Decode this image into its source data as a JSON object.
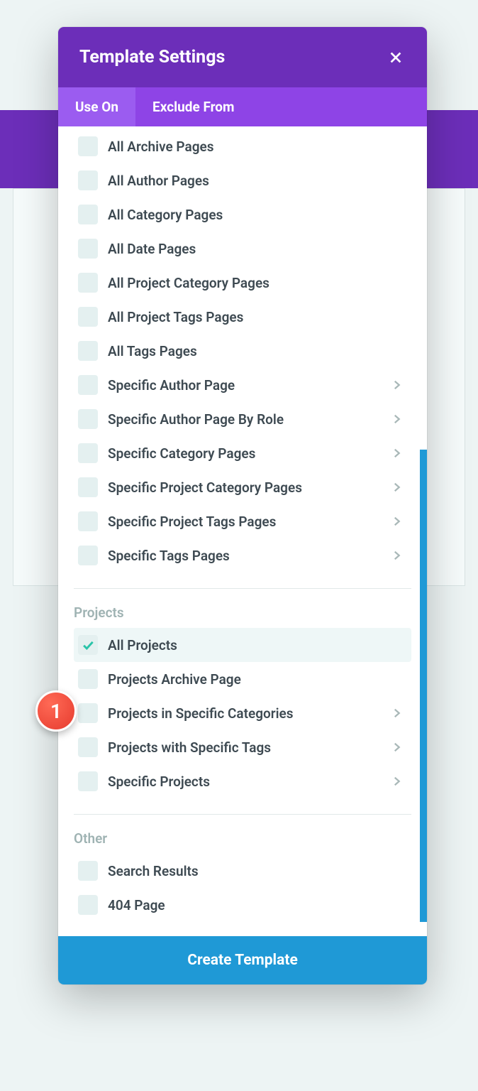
{
  "modal": {
    "title": "Template Settings",
    "tabs": {
      "use_on": "Use On",
      "exclude_from": "Exclude From"
    },
    "groups": [
      {
        "title": "",
        "items": [
          {
            "label": "All Archive Pages",
            "checked": false,
            "chevron": false
          },
          {
            "label": "All Author Pages",
            "checked": false,
            "chevron": false
          },
          {
            "label": "All Category Pages",
            "checked": false,
            "chevron": false
          },
          {
            "label": "All Date Pages",
            "checked": false,
            "chevron": false
          },
          {
            "label": "All Project Category Pages",
            "checked": false,
            "chevron": false
          },
          {
            "label": "All Project Tags Pages",
            "checked": false,
            "chevron": false
          },
          {
            "label": "All Tags Pages",
            "checked": false,
            "chevron": false
          },
          {
            "label": "Specific Author Page",
            "checked": false,
            "chevron": true
          },
          {
            "label": "Specific Author Page By Role",
            "checked": false,
            "chevron": true
          },
          {
            "label": "Specific Category Pages",
            "checked": false,
            "chevron": true
          },
          {
            "label": "Specific Project Category Pages",
            "checked": false,
            "chevron": true
          },
          {
            "label": "Specific Project Tags Pages",
            "checked": false,
            "chevron": true
          },
          {
            "label": "Specific Tags Pages",
            "checked": false,
            "chevron": true
          }
        ]
      },
      {
        "title": "Projects",
        "items": [
          {
            "label": "All Projects",
            "checked": true,
            "chevron": false
          },
          {
            "label": "Projects Archive Page",
            "checked": false,
            "chevron": false
          },
          {
            "label": "Projects in Specific Categories",
            "checked": false,
            "chevron": true
          },
          {
            "label": "Projects with Specific Tags",
            "checked": false,
            "chevron": true
          },
          {
            "label": "Specific Projects",
            "checked": false,
            "chevron": true
          }
        ]
      },
      {
        "title": "Other",
        "items": [
          {
            "label": "Search Results",
            "checked": false,
            "chevron": false
          },
          {
            "label": "404 Page",
            "checked": false,
            "chevron": false
          }
        ]
      }
    ],
    "footer_button": "Create Template"
  },
  "annotation": {
    "badge": "1"
  }
}
